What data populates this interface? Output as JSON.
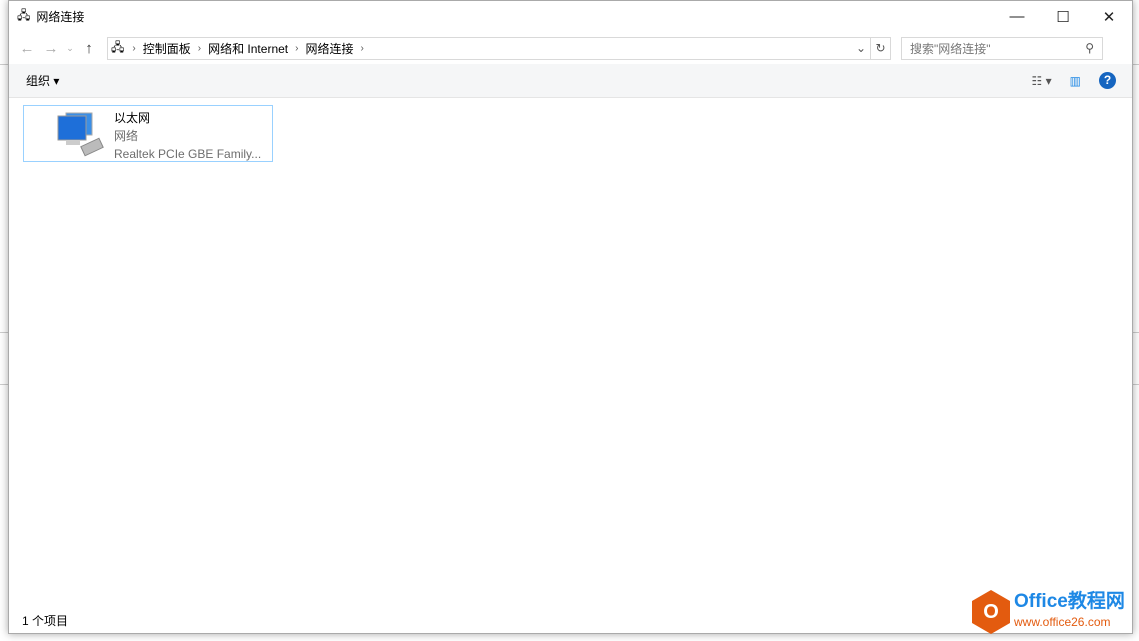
{
  "window": {
    "title": "网络连接"
  },
  "address": {
    "crumbs": [
      "控制面板",
      "网络和 Internet",
      "网络连接"
    ]
  },
  "search": {
    "placeholder": "搜索\"网络连接\""
  },
  "toolbar": {
    "organize": "组织 ▾"
  },
  "items": [
    {
      "name": "以太网",
      "status": "网络",
      "device": "Realtek PCIe GBE Family..."
    }
  ],
  "statusbar": {
    "count": "1 个项目"
  },
  "watermark": {
    "title": "Office教程网",
    "url": "www.office26.com"
  },
  "colors": {
    "accent": "#1565c0",
    "selection_border": "#99d1ff",
    "logo": "#e35b0f"
  }
}
